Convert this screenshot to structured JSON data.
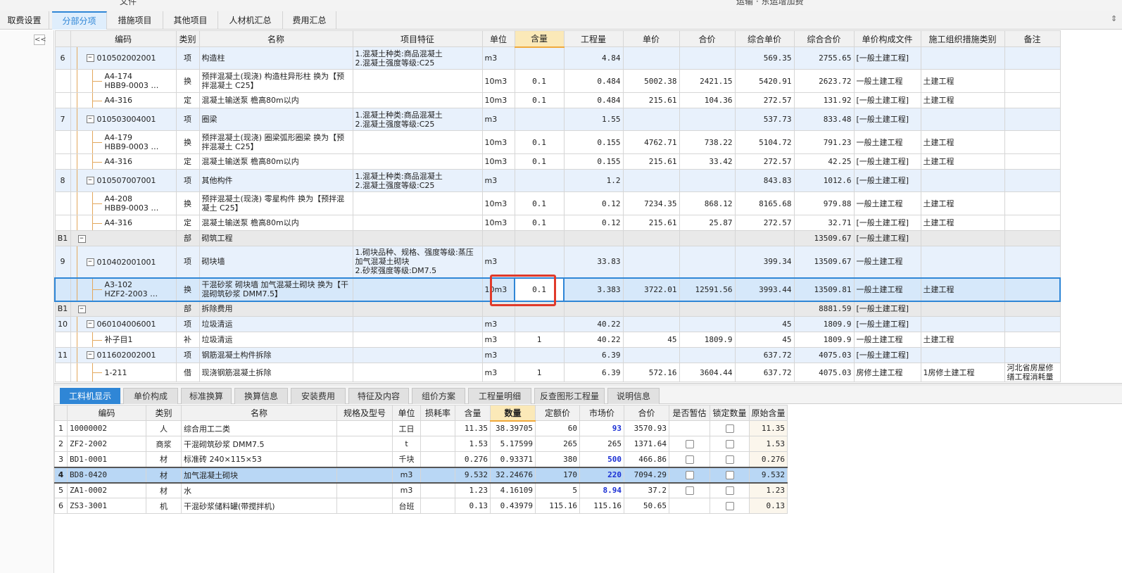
{
  "top_strip": {
    "left_text": "文件",
    "right_text": "运输 · 东运增加费"
  },
  "tabs": [
    {
      "label": "取费设置"
    },
    {
      "label": "分部分项"
    },
    {
      "label": "措施项目"
    },
    {
      "label": "其他项目"
    },
    {
      "label": "人材机汇总"
    },
    {
      "label": "费用汇总"
    }
  ],
  "active_tab": "分部分项",
  "collapse_label": "<<",
  "main_grid": {
    "headers": [
      "编码",
      "类别",
      "名称",
      "项目特征",
      "单位",
      "含量",
      "工程量",
      "单价",
      "合价",
      "综合单价",
      "综合合价",
      "单价构成文件",
      "施工组织措施类别",
      "备注"
    ],
    "rows": [
      {
        "idx": "6",
        "code": "010502002001",
        "type": "项",
        "name": "构造柱",
        "feature": "1.混凝土种类:商品混凝土\n2.混凝土强度等级:C25",
        "unit": "m3",
        "content": "",
        "qty": "4.84",
        "price": "",
        "total": "",
        "comp_price": "569.35",
        "comp_total": "2755.65",
        "file": "[一般土建工程]",
        "cat": "",
        "note": ""
      },
      {
        "idx": "",
        "code": "A4-174\nHBB9-0003 …",
        "type": "换",
        "name": "预拌混凝土(现浇) 构造柱异形柱  换为【预拌混凝土 C25】",
        "feature": "",
        "unit": "10m3",
        "content": "0.1",
        "qty": "0.484",
        "price": "5002.38",
        "total": "2421.15",
        "comp_price": "5420.91",
        "comp_total": "2623.72",
        "file": "一般土建工程",
        "cat": "土建工程",
        "note": ""
      },
      {
        "idx": "",
        "code": "A4-316",
        "type": "定",
        "name": "混凝土输送泵 檐高80m以内",
        "feature": "",
        "unit": "10m3",
        "content": "0.1",
        "qty": "0.484",
        "price": "215.61",
        "total": "104.36",
        "comp_price": "272.57",
        "comp_total": "131.92",
        "file": "[一般土建工程]",
        "cat": "土建工程",
        "note": ""
      },
      {
        "idx": "7",
        "code": "010503004001",
        "type": "项",
        "name": "圈梁",
        "feature": "1.混凝土种类:商品混凝土\n2.混凝土强度等级:C25",
        "unit": "m3",
        "content": "",
        "qty": "1.55",
        "price": "",
        "total": "",
        "comp_price": "537.73",
        "comp_total": "833.48",
        "file": "[一般土建工程]",
        "cat": "",
        "note": ""
      },
      {
        "idx": "",
        "code": "A4-179\nHBB9-0003 …",
        "type": "换",
        "name": "预拌混凝土(现浇) 圈梁弧形圈梁  换为【预拌混凝土 C25】",
        "feature": "",
        "unit": "10m3",
        "content": "0.1",
        "qty": "0.155",
        "price": "4762.71",
        "total": "738.22",
        "comp_price": "5104.72",
        "comp_total": "791.23",
        "file": "一般土建工程",
        "cat": "土建工程",
        "note": ""
      },
      {
        "idx": "",
        "code": "A4-316",
        "type": "定",
        "name": "混凝土输送泵 檐高80m以内",
        "feature": "",
        "unit": "10m3",
        "content": "0.1",
        "qty": "0.155",
        "price": "215.61",
        "total": "33.42",
        "comp_price": "272.57",
        "comp_total": "42.25",
        "file": "[一般土建工程]",
        "cat": "土建工程",
        "note": ""
      },
      {
        "idx": "8",
        "code": "010507007001",
        "type": "项",
        "name": "其他构件",
        "feature": "1.混凝土种类:商品混凝土\n2.混凝土强度等级:C25",
        "unit": "m3",
        "content": "",
        "qty": "1.2",
        "price": "",
        "total": "",
        "comp_price": "843.83",
        "comp_total": "1012.6",
        "file": "[一般土建工程]",
        "cat": "",
        "note": ""
      },
      {
        "idx": "",
        "code": "A4-208\nHBB9-0003 …",
        "type": "换",
        "name": "预拌混凝土(现浇) 零星构件  换为【预拌混凝土 C25】",
        "feature": "",
        "unit": "10m3",
        "content": "0.1",
        "qty": "0.12",
        "price": "7234.35",
        "total": "868.12",
        "comp_price": "8165.68",
        "comp_total": "979.88",
        "file": "一般土建工程",
        "cat": "土建工程",
        "note": ""
      },
      {
        "idx": "",
        "code": "A4-316",
        "type": "定",
        "name": "混凝土输送泵 檐高80m以内",
        "feature": "",
        "unit": "10m3",
        "content": "0.1",
        "qty": "0.12",
        "price": "215.61",
        "total": "25.87",
        "comp_price": "272.57",
        "comp_total": "32.71",
        "file": "[一般土建工程]",
        "cat": "土建工程",
        "note": ""
      },
      {
        "idx": "B1",
        "code": "",
        "type": "部",
        "name": "砌筑工程",
        "feature": "",
        "unit": "",
        "content": "",
        "qty": "",
        "price": "",
        "total": "",
        "comp_price": "",
        "comp_total": "13509.67",
        "file": "[一般土建工程]",
        "cat": "",
        "note": ""
      },
      {
        "idx": "9",
        "code": "010402001001",
        "type": "项",
        "name": "砌块墙",
        "feature": "1.砌块品种、规格、强度等级:蒸压加气混凝土砌块\n2.砂浆强度等级:DM7.5",
        "unit": "m3",
        "content": "",
        "qty": "33.83",
        "price": "",
        "total": "",
        "comp_price": "399.34",
        "comp_total": "13509.67",
        "file": "一般土建工程",
        "cat": "",
        "note": ""
      },
      {
        "idx": "",
        "code": "A3-102\nHZF2-2003 …",
        "type": "换",
        "name": "干混砂浆 砌块墙 加气混凝土砌块  换为【干混砌筑砂浆 DMM7.5】",
        "feature": "",
        "unit": "10m3",
        "content": "0.1",
        "qty": "3.383",
        "price": "3722.01",
        "total": "12591.56",
        "comp_price": "3993.44",
        "comp_total": "13509.81",
        "file": "一般土建工程",
        "cat": "土建工程",
        "note": ""
      },
      {
        "idx": "B1",
        "code": "",
        "type": "部",
        "name": "拆除费用",
        "feature": "",
        "unit": "",
        "content": "",
        "qty": "",
        "price": "",
        "total": "",
        "comp_price": "",
        "comp_total": "8881.59",
        "file": "[一般土建工程]",
        "cat": "",
        "note": ""
      },
      {
        "idx": "10",
        "code": "060104006001",
        "type": "项",
        "name": "垃圾清运",
        "feature": "",
        "unit": "m3",
        "content": "",
        "qty": "40.22",
        "price": "",
        "total": "",
        "comp_price": "45",
        "comp_total": "1809.9",
        "file": "[一般土建工程]",
        "cat": "",
        "note": ""
      },
      {
        "idx": "",
        "code": "补子目1",
        "type": "补",
        "name": "垃圾清运",
        "feature": "",
        "unit": "m3",
        "content": "1",
        "qty": "40.22",
        "price": "45",
        "total": "1809.9",
        "comp_price": "45",
        "comp_total": "1809.9",
        "file": "一般土建工程",
        "cat": "土建工程",
        "note": ""
      },
      {
        "idx": "11",
        "code": "011602002001",
        "type": "项",
        "name": "钢筋混凝土构件拆除",
        "feature": "",
        "unit": "m3",
        "content": "",
        "qty": "6.39",
        "price": "",
        "total": "",
        "comp_price": "637.72",
        "comp_total": "4075.03",
        "file": "[一般土建工程]",
        "cat": "",
        "note": ""
      },
      {
        "idx": "",
        "code": "1-211",
        "type": "借",
        "name": "现浇钢筋混凝土拆除",
        "feature": "",
        "unit": "m3",
        "content": "1",
        "qty": "6.39",
        "price": "572.16",
        "total": "3604.44",
        "comp_price": "637.72",
        "comp_total": "4075.03",
        "file": "房修土建工程",
        "cat": "1房修土建工程",
        "note": "河北省房屋修缮工程消耗量"
      }
    ]
  },
  "bottom_tabs": [
    {
      "label": "工料机显示"
    },
    {
      "label": "单价构成"
    },
    {
      "label": "标准换算"
    },
    {
      "label": "换算信息"
    },
    {
      "label": "安装费用"
    },
    {
      "label": "特征及内容"
    },
    {
      "label": "组价方案"
    },
    {
      "label": "工程量明细"
    },
    {
      "label": "反查图形工程量"
    },
    {
      "label": "说明信息"
    }
  ],
  "sub_grid": {
    "headers": [
      "编码",
      "类别",
      "名称",
      "规格及型号",
      "单位",
      "损耗率",
      "含量",
      "数量",
      "定额价",
      "市场价",
      "合价",
      "是否暂估",
      "锁定数量",
      "原始含量"
    ],
    "rows": [
      {
        "idx": "1",
        "code": "10000002",
        "type": "人",
        "name": "综合用工二类",
        "spec": "",
        "unit": "工日",
        "loss": "",
        "content": "11.35",
        "qty": "38.39705",
        "quota": "60",
        "market": "93",
        "total": "3570.93",
        "estimate": false,
        "lock": true,
        "orig": "11.35"
      },
      {
        "idx": "2",
        "code": "ZF2-2002",
        "type": "商浆",
        "name": "干混砌筑砂浆 DMM7.5",
        "spec": "",
        "unit": "t",
        "loss": "",
        "content": "1.53",
        "qty": "5.17599",
        "quota": "265",
        "market": "265",
        "total": "1371.64",
        "estimate": true,
        "lock": true,
        "orig": "1.53"
      },
      {
        "idx": "3",
        "code": "BD1-0001",
        "type": "材",
        "name": "标准砖 240×115×53",
        "spec": "",
        "unit": "千块",
        "loss": "",
        "content": "0.276",
        "qty": "0.93371",
        "quota": "380",
        "market": "500",
        "total": "466.86",
        "estimate": true,
        "lock": true,
        "orig": "0.276"
      },
      {
        "idx": "4",
        "code": "BD8-0420",
        "type": "材",
        "name": "加气混凝土砌块",
        "spec": "",
        "unit": "m3",
        "loss": "",
        "content": "9.532",
        "qty": "32.24676",
        "quota": "170",
        "market": "220",
        "total": "7094.29",
        "estimate": true,
        "lock": true,
        "orig": "9.532"
      },
      {
        "idx": "5",
        "code": "ZA1-0002",
        "type": "材",
        "name": "水",
        "spec": "",
        "unit": "m3",
        "loss": "",
        "content": "1.23",
        "qty": "4.16109",
        "quota": "5",
        "market": "8.94",
        "total": "37.2",
        "estimate": true,
        "lock": true,
        "orig": "1.23"
      },
      {
        "idx": "6",
        "code": "ZS3-3001",
        "type": "机",
        "name": "干混砂浆储料罐(带搅拌机)",
        "spec": "",
        "unit": "台班",
        "loss": "",
        "content": "0.13",
        "qty": "0.43979",
        "quota": "115.16",
        "market": "115.16",
        "total": "50.65",
        "estimate": false,
        "lock": true,
        "orig": "0.13"
      }
    ]
  },
  "colors": {
    "accent": "#2f86d6",
    "highlight_header": "#fbe9b8",
    "qd_row": "#e8f1fc",
    "fb_row": "#e9e9e9",
    "annotation": "#e03a2a",
    "market_changed": "#1a2fd4"
  }
}
